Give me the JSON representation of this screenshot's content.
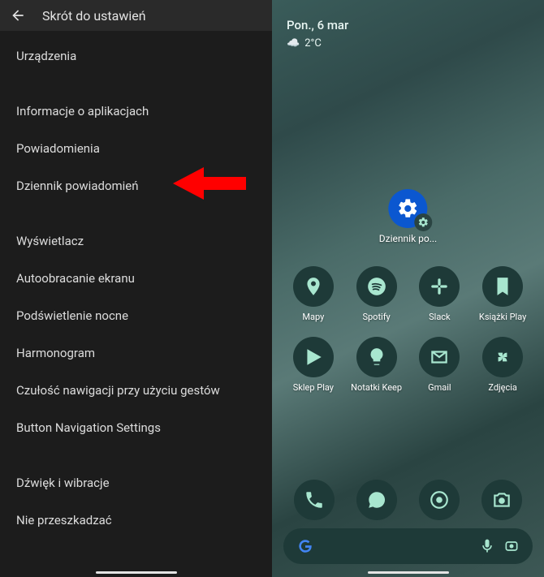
{
  "left": {
    "title": "Skrót do ustawień",
    "items": [
      "Urządzenia",
      "Informacje o aplikacjach",
      "Powiadomienia",
      "Dziennik powiadomień",
      "Wyświetlacz",
      "Autoobracanie ekranu",
      "Podświetlenie nocne",
      "Harmonogram",
      "Czułość nawigacji przy użyciu gestów",
      "Button Navigation Settings",
      "Dźwięk i wibracje",
      "Nie przeszkadzać"
    ],
    "highlighted_index": 3
  },
  "right": {
    "date": "Pon., 6 mar",
    "weather_temp": "2°C",
    "widget_label": "Dziennik po...",
    "apps_row1": [
      {
        "label": "Mapy",
        "icon": "pin-icon"
      },
      {
        "label": "Spotify",
        "icon": "spotify-icon"
      },
      {
        "label": "Slack",
        "icon": "slack-icon"
      },
      {
        "label": "Książki Play",
        "icon": "bookmark-icon"
      }
    ],
    "apps_row2": [
      {
        "label": "Sklep Play",
        "icon": "play-icon"
      },
      {
        "label": "Notatki Keep",
        "icon": "bulb-icon"
      },
      {
        "label": "Gmail",
        "icon": "gmail-icon"
      },
      {
        "label": "Zdjęcia",
        "icon": "pinwheel-icon"
      }
    ],
    "dock": [
      {
        "icon": "phone-icon"
      },
      {
        "icon": "chat-icon"
      },
      {
        "icon": "chrome-icon"
      },
      {
        "icon": "camera-icon"
      }
    ]
  }
}
